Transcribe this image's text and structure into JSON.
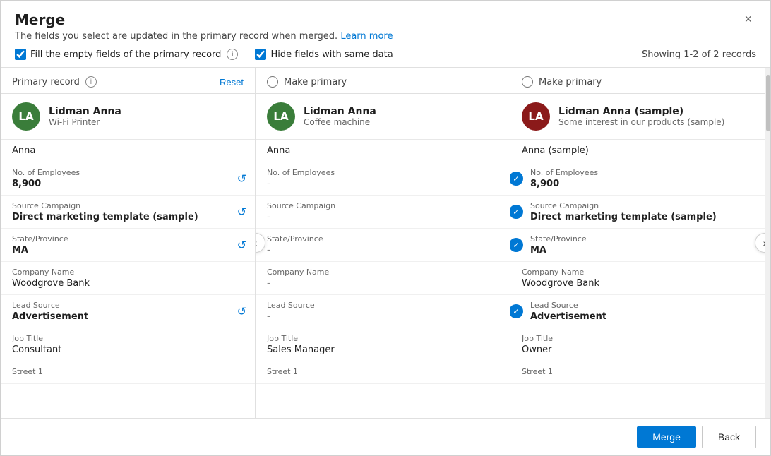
{
  "dialog": {
    "title": "Merge",
    "subtitle": "The fields you select are updated in the primary record when merged.",
    "learn_more": "Learn more",
    "close_label": "×",
    "showing": "Showing 1-2 of 2 records"
  },
  "options": {
    "fill_empty": "Fill the empty fields of the primary record",
    "hide_same": "Hide fields with same data"
  },
  "col1": {
    "header_label": "Primary record",
    "reset_label": "Reset",
    "avatar_initials": "LA",
    "avatar_color": "green",
    "record_name": "Lidman Anna",
    "record_sub": "Wi-Fi Printer",
    "first_name": "Anna",
    "num_employees_label": "No. of Employees",
    "num_employees": "8,900",
    "source_campaign_label": "Source Campaign",
    "source_campaign": "Direct marketing template (sample)",
    "state_label": "State/Province",
    "state": "MA",
    "company_label": "Company Name",
    "company": "Woodgrove Bank",
    "lead_source_label": "Lead Source",
    "lead_source": "Advertisement",
    "job_title_label": "Job Title",
    "job_title": "Consultant",
    "street_label": "Street 1"
  },
  "col2": {
    "make_primary": "Make primary",
    "avatar_initials": "LA",
    "avatar_color": "green",
    "record_name": "Lidman Anna",
    "record_sub": "Coffee machine",
    "first_name": "Anna",
    "num_employees_label": "No. of Employees",
    "num_employees": "-",
    "source_campaign_label": "Source Campaign",
    "source_campaign": "-",
    "state_label": "State/Province",
    "state": "-",
    "company_label": "Company Name",
    "company": "-",
    "lead_source_label": "Lead Source",
    "lead_source": "-",
    "job_title_label": "Job Title",
    "job_title": "Sales Manager",
    "street_label": "Street 1"
  },
  "col3": {
    "make_primary": "Make primary",
    "avatar_initials": "LA",
    "avatar_color": "darkred",
    "record_name": "Lidman Anna (sample)",
    "record_sub": "Some interest in our products (sample)",
    "first_name": "Anna (sample)",
    "num_employees_label": "No. of Employees",
    "num_employees": "8,900",
    "source_campaign_label": "Source Campaign",
    "source_campaign": "Direct marketing template (sample)",
    "state_label": "State/Province",
    "state": "MA",
    "company_label": "Company Name",
    "company": "Woodgrove Bank",
    "lead_source_label": "Lead Source",
    "lead_source": "Advertisement",
    "job_title_label": "Job Title",
    "job_title": "Owner",
    "street_label": "Street 1"
  },
  "footer": {
    "merge_label": "Merge",
    "back_label": "Back"
  }
}
